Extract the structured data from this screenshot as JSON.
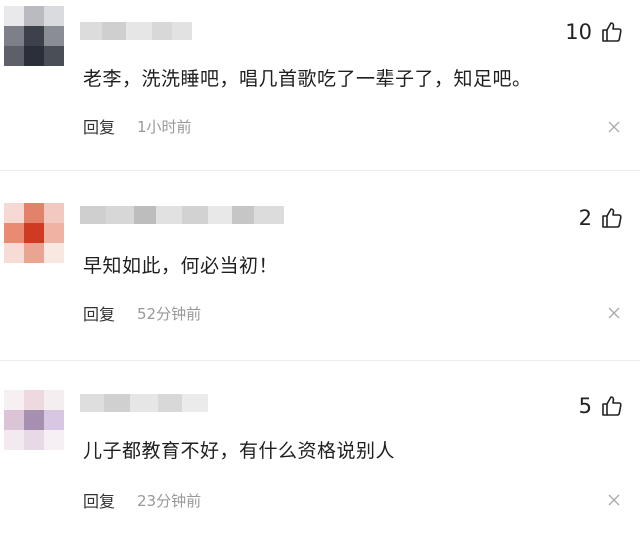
{
  "comments": [
    {
      "text": "老李，洗洗睡吧，唱几首歌吃了一辈子了，知足吧。",
      "likes": "10",
      "reply_label": "回复",
      "time": "1小时前",
      "avatar_colors": [
        "#e9e9ec",
        "#b9bbc0",
        "#dadbde",
        "#7d8088",
        "#3d414b",
        "#8a8d94",
        "#5d6068",
        "#2b2f39",
        "#4a4e57"
      ],
      "name_blur_colors": [
        "#dcdcdc",
        "#cfcfcf",
        "#e6e6e6",
        "#d8d8d8",
        "#e2e2e2"
      ]
    },
    {
      "text": "早知如此，何必当初！",
      "likes": "2",
      "reply_label": "回复",
      "time": "52分钟前",
      "avatar_colors": [
        "#f6d9d2",
        "#e3826b",
        "#f1c9c0",
        "#e98a73",
        "#cf3a22",
        "#efb3a3",
        "#f6dcd5",
        "#e9a591",
        "#f9e7e1"
      ],
      "name_blur_colors": [
        "#cfcfcf",
        "#d7d7d7",
        "#bdbdbd",
        "#e1e1e1",
        "#d2d2d2",
        "#e8e8e8",
        "#c6c6c6",
        "#dcdcdc"
      ]
    },
    {
      "text": "儿子都教育不好，有什么资格说别人",
      "likes": "5",
      "reply_label": "回复",
      "time": "23分钟前",
      "avatar_colors": [
        "#f7f0f3",
        "#eed9e1",
        "#f5eef1",
        "#dcc4d7",
        "#a78fb1",
        "#d7c7e3",
        "#f3eaf0",
        "#e8d9e6",
        "#f6f0f5"
      ],
      "name_blur_colors": [
        "#dedede",
        "#d0d0d0",
        "#e6e6e6",
        "#d8d8d8",
        "#ebebeb"
      ]
    }
  ]
}
